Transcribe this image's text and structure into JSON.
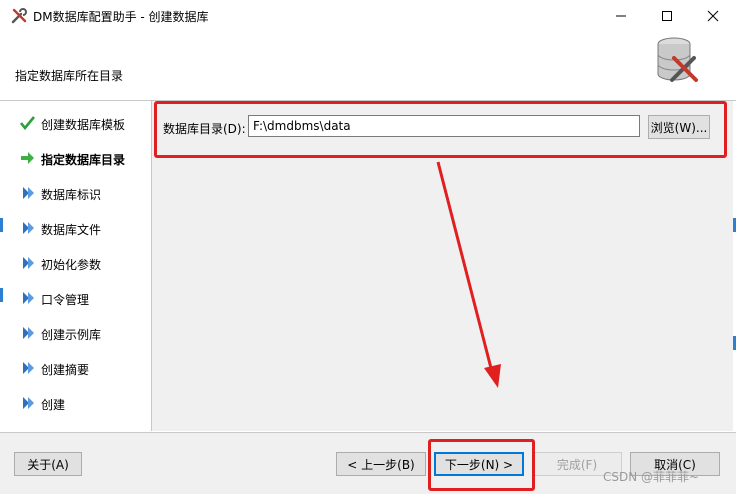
{
  "window": {
    "title": "DM数据库配置助手 - 创建数据库",
    "icons": {
      "app": "tools-icon",
      "minimize": "minimize-icon",
      "maximize": "maximize-icon",
      "close": "close-icon"
    }
  },
  "header": {
    "subtitle": "指定数据库所在目录",
    "icon": "database-tools-icon"
  },
  "steps": [
    {
      "label": "创建数据库模板",
      "icon": "checkmark-icon",
      "state": "done"
    },
    {
      "label": "指定数据库目录",
      "icon": "arrow-right-icon",
      "state": "current"
    },
    {
      "label": "数据库标识",
      "icon": "diamond-icon",
      "state": "pending"
    },
    {
      "label": "数据库文件",
      "icon": "diamond-icon",
      "state": "pending"
    },
    {
      "label": "初始化参数",
      "icon": "diamond-icon",
      "state": "pending"
    },
    {
      "label": "口令管理",
      "icon": "diamond-icon",
      "state": "pending"
    },
    {
      "label": "创建示例库",
      "icon": "diamond-icon",
      "state": "pending"
    },
    {
      "label": "创建摘要",
      "icon": "diamond-icon",
      "state": "pending"
    },
    {
      "label": "创建",
      "icon": "diamond-icon",
      "state": "pending"
    }
  ],
  "form": {
    "dir_label": "数据库目录(D):",
    "dir_value": "F:\\dmdbms\\data",
    "browse_label": "浏览(W)..."
  },
  "footer": {
    "about_label": "关于(A)",
    "prev_label": "< 上一步(B)",
    "next_label": "下一步(N) >",
    "finish_label": "完成(F)",
    "cancel_label": "取消(C)"
  },
  "watermark": "CSDN @菲菲菲~",
  "colors": {
    "highlight": "#e02020",
    "accent_blue": "#0078d7",
    "check_green": "#2e9e3e",
    "current_arrow_green": "#3cb043",
    "pending_blue": "#2f6fc0"
  }
}
